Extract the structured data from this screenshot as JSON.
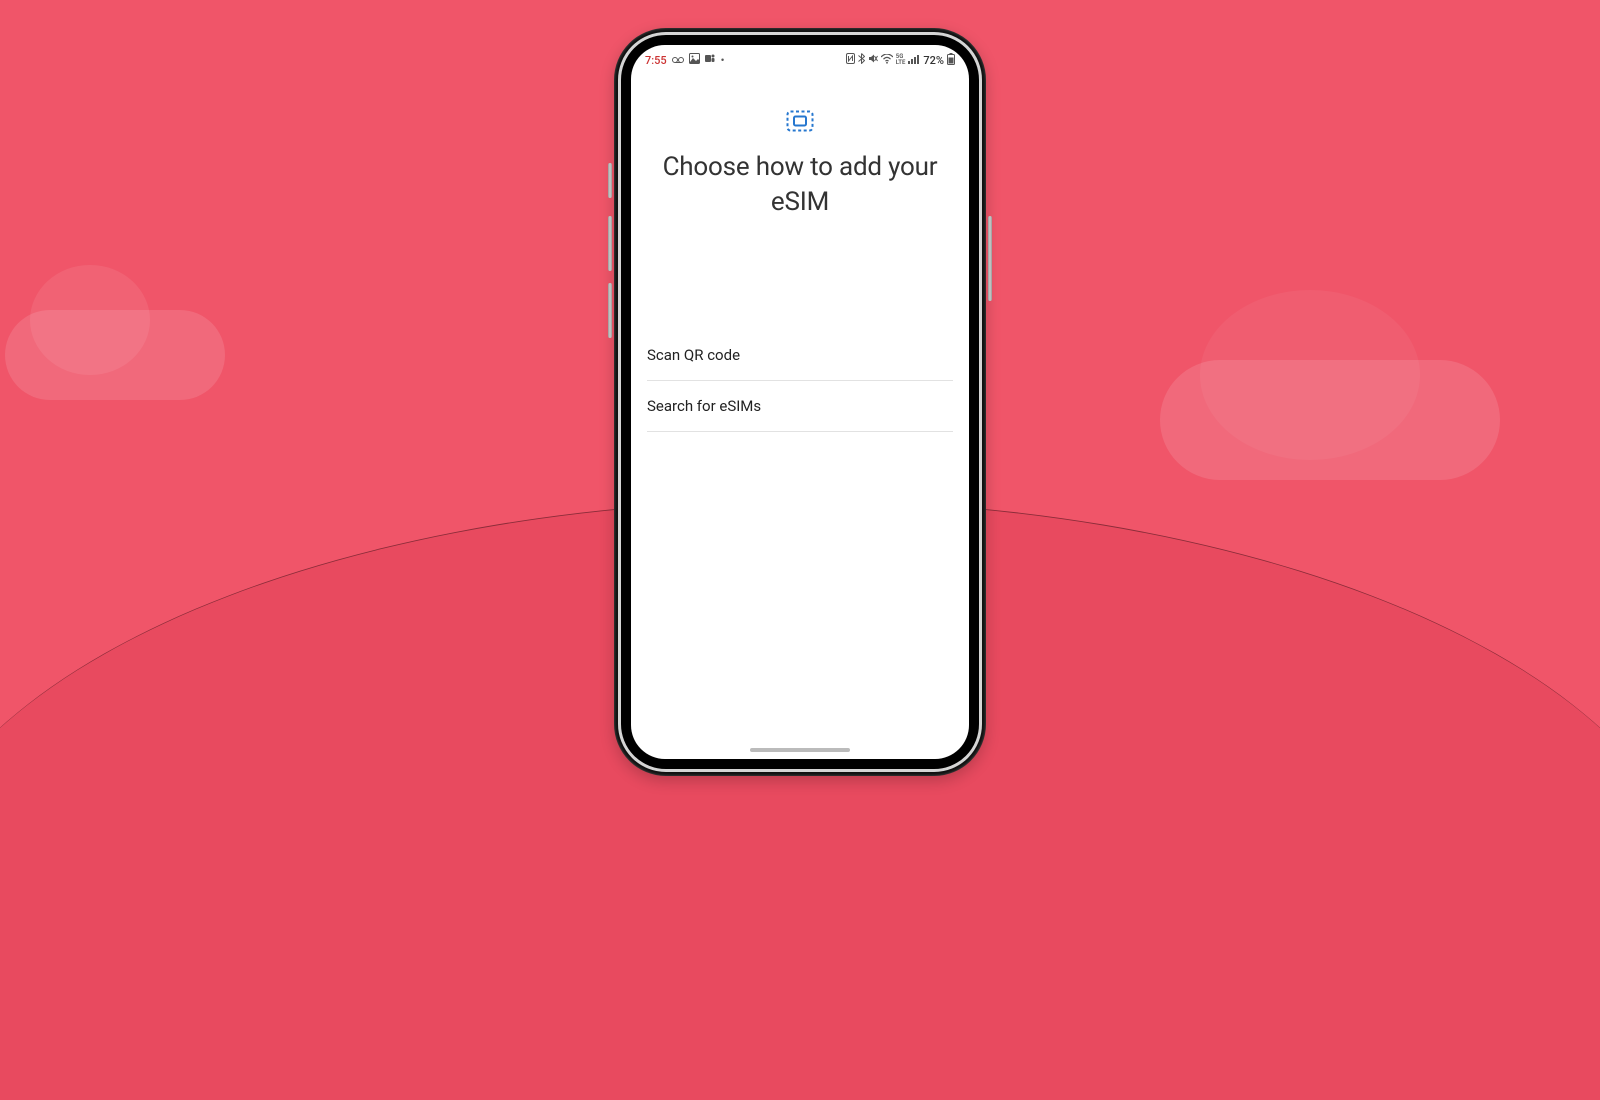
{
  "status": {
    "time": "7:55",
    "indicator_icons": "⚬⚬ 🖼 📇 •",
    "battery_text": "72%",
    "signal_text": "5G LTE"
  },
  "screen": {
    "title": "Choose how to add your eSIM",
    "options": [
      {
        "label": "Scan QR code"
      },
      {
        "label": "Search for eSIMs"
      }
    ]
  }
}
